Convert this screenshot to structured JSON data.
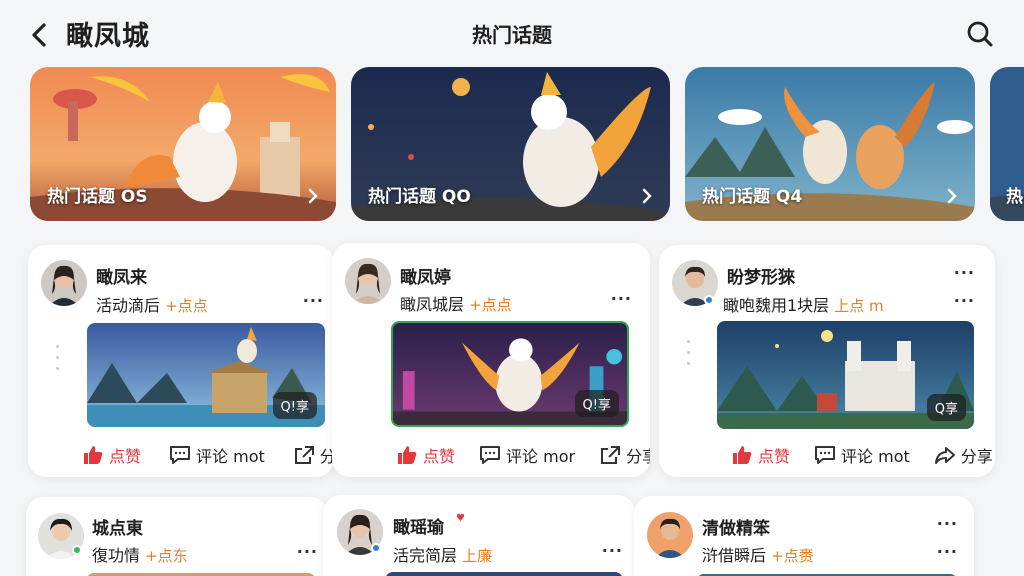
{
  "header": {
    "app_title": "瞰凤城",
    "page_title": "热门话题",
    "back_icon": "chevron-left-icon",
    "search_icon": "search-icon"
  },
  "banners": [
    {
      "label": "热门话题 OS",
      "icon": "chevron-right-icon"
    },
    {
      "label": "热门话题 QO",
      "icon": "chevron-right-icon"
    },
    {
      "label": "热门话题 Q4",
      "icon": "chevron-right-icon"
    },
    {
      "label": "热"
    }
  ],
  "posts": [
    {
      "name": "瞰凤来",
      "subtitle": "活动滴后",
      "tag": "+点点",
      "badge": "Q!享",
      "like": "点赞",
      "comment": "评论 mot",
      "share": "分享"
    },
    {
      "name": "瞰凤婷",
      "subtitle": "瞰凤城层",
      "tag": "+点点",
      "badge": "Q!享",
      "like": "点赞",
      "comment": "评论 mor",
      "share": "分享"
    },
    {
      "name": "盼梦形猍",
      "subtitle": "瞰咆魏用1块层",
      "tag": "上点 m",
      "badge": "Q享",
      "like": "点赞",
      "comment": "评论 mot",
      "share": "分享"
    },
    {
      "name": "城点東",
      "subtitle": "復功情",
      "tag": "+点东"
    },
    {
      "name": "瞰瑶瑜",
      "subtitle": "活完简层",
      "tag": "上廉"
    },
    {
      "name": "清做精笨",
      "subtitle": "浒借瞬后",
      "tag": "+点赉"
    }
  ],
  "colors": {
    "like": "#e0393e",
    "tag": "#e67e22",
    "background": "#f4f5f7"
  }
}
